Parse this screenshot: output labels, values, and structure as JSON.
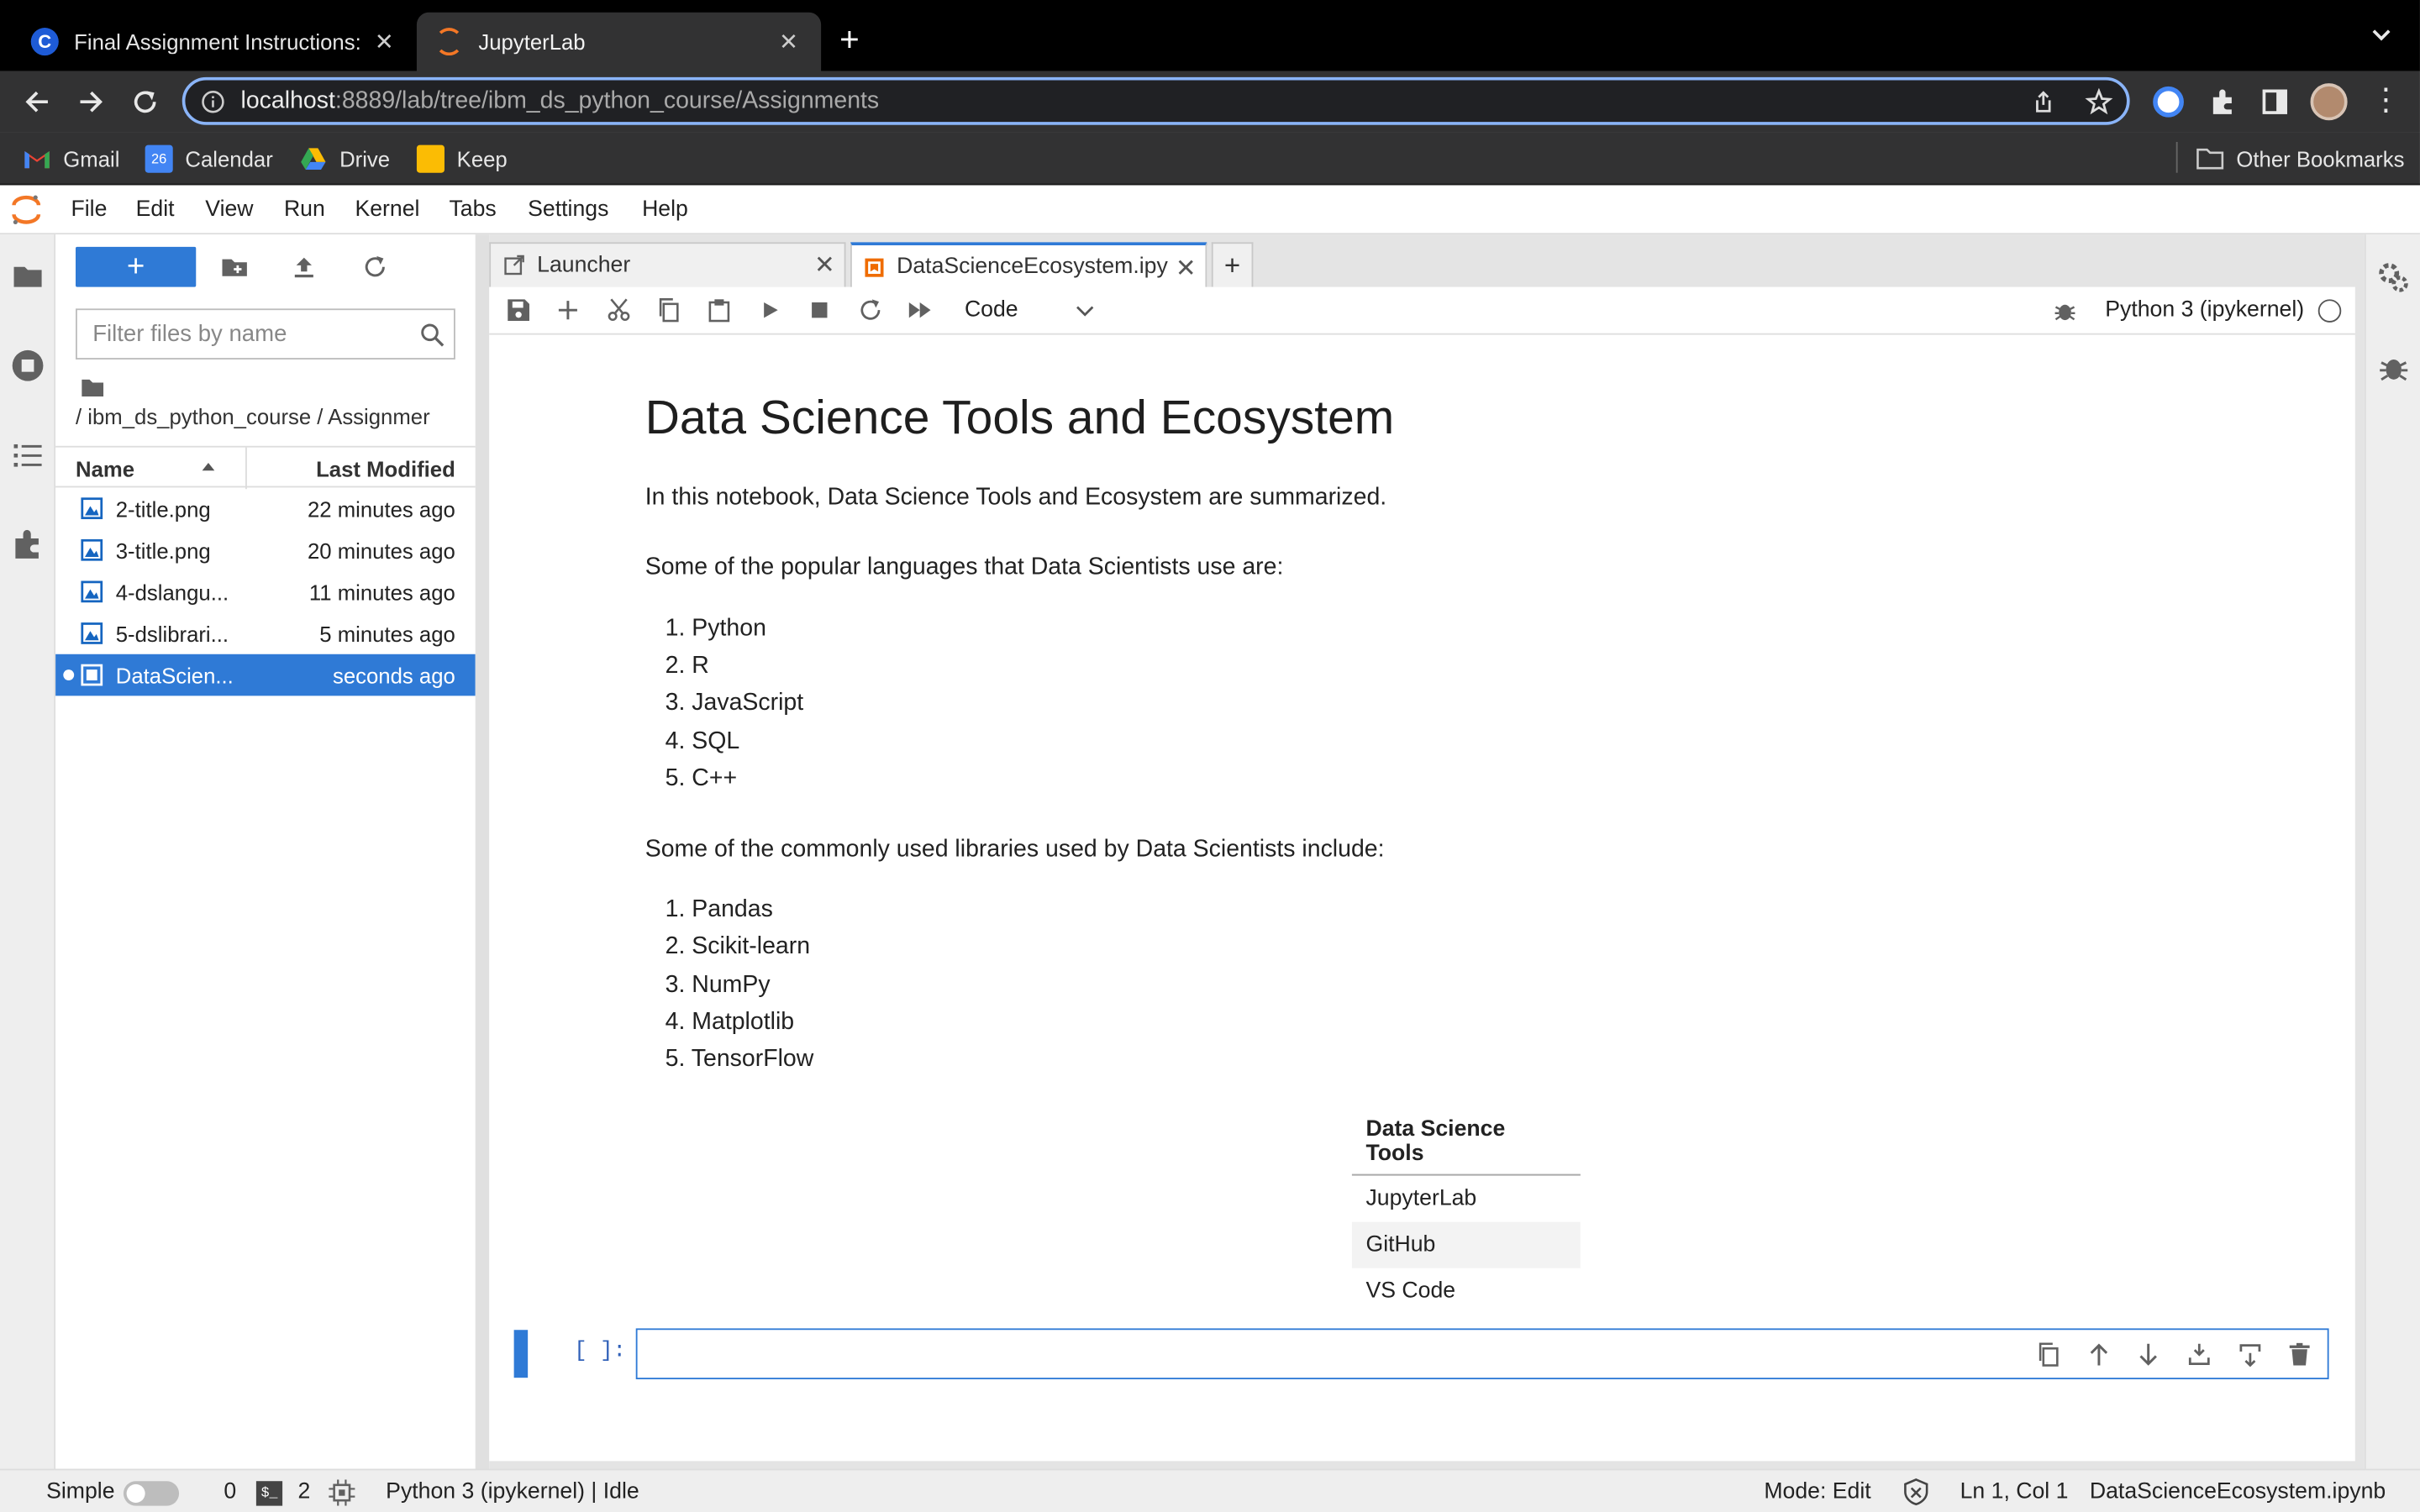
{
  "browser": {
    "tabs": [
      {
        "title": "Final Assignment Instructions:",
        "favicon": "coursera-icon"
      },
      {
        "title": "JupyterLab",
        "favicon": "jupyter-icon"
      }
    ],
    "url_host": "localhost",
    "url_rest": ":8889/lab/tree/ibm_ds_python_course/Assignments",
    "bookmarks": [
      "Gmail",
      "Calendar",
      "Drive",
      "Keep"
    ],
    "other_bookmarks": "Other Bookmarks",
    "calendar_day": "26"
  },
  "menu": [
    "File",
    "Edit",
    "View",
    "Run",
    "Kernel",
    "Tabs",
    "Settings",
    "Help"
  ],
  "filebrowser": {
    "new_label": "+",
    "filter_placeholder": "Filter files by name",
    "breadcrumb": "/ ibm_ds_python_course / Assignmer",
    "col_name": "Name",
    "col_modified": "Last Modified",
    "files": [
      {
        "name": "2-title.png",
        "modified": "22 minutes ago"
      },
      {
        "name": "3-title.png",
        "modified": "20 minutes ago"
      },
      {
        "name": "4-dslangu...",
        "modified": "11 minutes ago"
      },
      {
        "name": "5-dslibrari...",
        "modified": "5 minutes ago"
      },
      {
        "name": "DataScien...",
        "modified": "seconds ago"
      }
    ]
  },
  "notebook": {
    "tabs": [
      "Launcher",
      "DataScienceEcosystem.ipy"
    ],
    "cell_type": "Code",
    "kernel": "Python 3 (ipykernel)",
    "title": "Data Science Tools and Ecosystem",
    "intro": "In this notebook, Data Science Tools and Ecosystem are summarized.",
    "languages_intro": "Some of the popular languages that Data Scientists use are:",
    "languages": [
      "1. Python",
      "2. R",
      "3. JavaScript",
      "4. SQL",
      "5. C++"
    ],
    "libraries_intro": "Some of the commonly used libraries used by Data Scientists include:",
    "libraries": [
      "1. Pandas",
      "2. Scikit-learn",
      "3. NumPy",
      "4. Matplotlib",
      "5. TensorFlow"
    ],
    "table_header": "Data Science Tools",
    "tools": [
      "JupyterLab",
      "GitHub",
      "VS Code"
    ],
    "prompt": "[ ]:"
  },
  "status": {
    "mode_label": "Simple",
    "terminals": "0",
    "kernels": "2",
    "kernel_status": "Python 3 (ipykernel) | Idle",
    "mode": "Mode: Edit",
    "cursor": "Ln 1, Col 1",
    "file": "DataScienceEcosystem.ipynb"
  },
  "colors": {
    "accent": "#2f7ad6",
    "jupyter_orange": "#f37726"
  }
}
